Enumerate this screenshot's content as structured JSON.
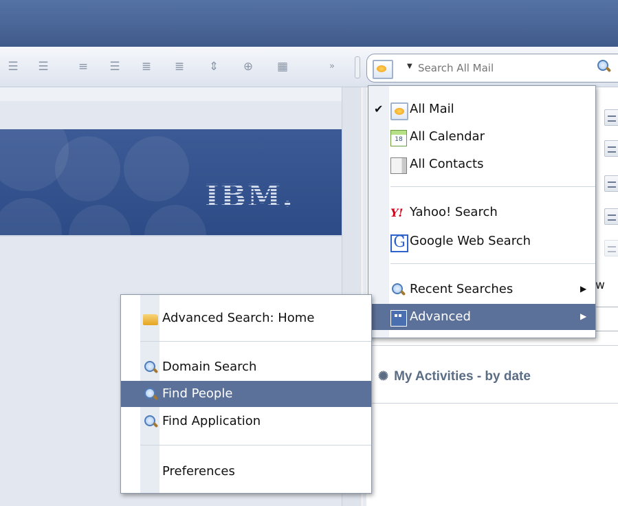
{
  "search": {
    "placeholder": "Search All Mail",
    "scope_icon": "mail-scope-icon",
    "go_icon": "magnifier-icon"
  },
  "toolbar": {
    "icons": [
      "bullet-list-icon",
      "numbered-list-icon",
      "align-center-icon",
      "justify-icon",
      "align-left-icon",
      "align-right-icon",
      "line-spacing-icon",
      "find-replace-icon",
      "table-icon",
      "overflow-chevron-icon"
    ]
  },
  "banner": {
    "logo": "IBM."
  },
  "scope_menu": {
    "items": [
      {
        "label": "All Mail",
        "icon": "mail-icon",
        "checked": true
      },
      {
        "label": "All Calendar",
        "icon": "calendar-icon",
        "calendar_day": "18"
      },
      {
        "label": "All Contacts",
        "icon": "contacts-icon"
      },
      {
        "label": "Yahoo! Search",
        "icon": "yahoo-icon",
        "glyph": "Y!"
      },
      {
        "label": "Google Web Search",
        "icon": "google-icon",
        "glyph": "G"
      },
      {
        "label": "Recent Searches",
        "icon": "search-icon",
        "submenu": true
      },
      {
        "label": "Advanced",
        "icon": "advanced-icon",
        "submenu": true,
        "highlighted": true
      }
    ]
  },
  "advanced_menu": {
    "items": [
      {
        "label": "Advanced Search: Home",
        "icon": "folder-icon"
      },
      {
        "label": "Domain Search",
        "icon": "search-icon"
      },
      {
        "label": "Find People",
        "icon": "search-icon",
        "highlighted": true
      },
      {
        "label": "Find Application",
        "icon": "search-icon"
      },
      {
        "label": "Preferences"
      }
    ]
  },
  "right_pane": {
    "partial_text": "w",
    "activities_title": "My Activities  - by date"
  },
  "colors": {
    "highlight": "#5c7199",
    "title_bar": "#4a6597",
    "banner": "#2d4b86"
  }
}
